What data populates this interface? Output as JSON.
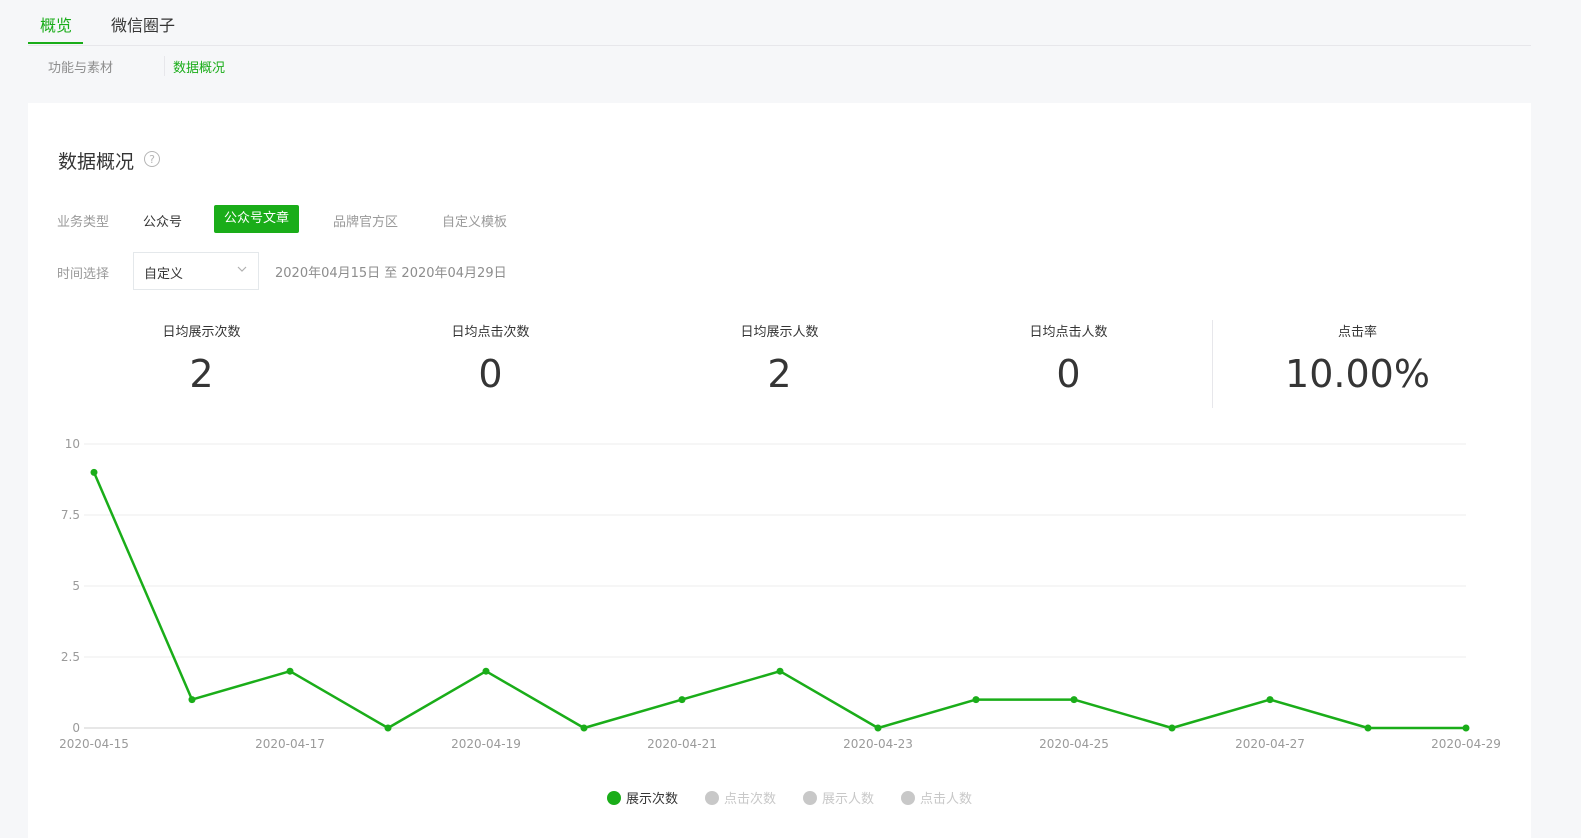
{
  "top_tabs": [
    {
      "label": "概览",
      "active": true
    },
    {
      "label": "微信圈子",
      "active": false
    }
  ],
  "sub_tabs": [
    {
      "label": "功能与素材",
      "active": false
    },
    {
      "label": "数据概况",
      "active": true
    }
  ],
  "card": {
    "title": "数据概况",
    "help_icon": "?",
    "business_type": {
      "label": "业务类型",
      "options": [
        "公众号",
        "公众号文章",
        "品牌官方区",
        "自定义模板"
      ],
      "selected": "公众号文章"
    },
    "time_select": {
      "label": "时间选择",
      "value": "自定义",
      "range": "2020年04月15日 至 2020年04月29日"
    },
    "kpis": [
      {
        "label": "日均展示次数",
        "value": "2"
      },
      {
        "label": "日均点击次数",
        "value": "0"
      },
      {
        "label": "日均展示人数",
        "value": "2"
      },
      {
        "label": "日均点击人数",
        "value": "0"
      },
      {
        "label": "点击率",
        "value": "10.00%"
      }
    ]
  },
  "colors": {
    "accent": "#1aad19",
    "legend_inactive": "#c8c8c8"
  },
  "chart_data": {
    "type": "line",
    "x": [
      "2020-04-15",
      "2020-04-16",
      "2020-04-17",
      "2020-04-18",
      "2020-04-19",
      "2020-04-20",
      "2020-04-21",
      "2020-04-22",
      "2020-04-23",
      "2020-04-24",
      "2020-04-25",
      "2020-04-26",
      "2020-04-27",
      "2020-04-28",
      "2020-04-29"
    ],
    "x_tick_labels": [
      "2020-04-15",
      "2020-04-17",
      "2020-04-19",
      "2020-04-21",
      "2020-04-23",
      "2020-04-25",
      "2020-04-27",
      "2020-04-29"
    ],
    "y_ticks": [
      "0",
      "2.5",
      "5",
      "7.5",
      "10"
    ],
    "ylim": [
      0,
      10
    ],
    "grid": true,
    "legend_placement": "bottom-center",
    "series": [
      {
        "name": "展示次数",
        "active": true,
        "values": [
          9,
          1,
          2,
          0,
          2,
          0,
          1,
          2,
          0,
          1,
          1,
          0,
          1,
          0,
          0
        ]
      },
      {
        "name": "点击次数",
        "active": false
      },
      {
        "name": "展示人数",
        "active": false
      },
      {
        "name": "点击人数",
        "active": false
      }
    ]
  }
}
